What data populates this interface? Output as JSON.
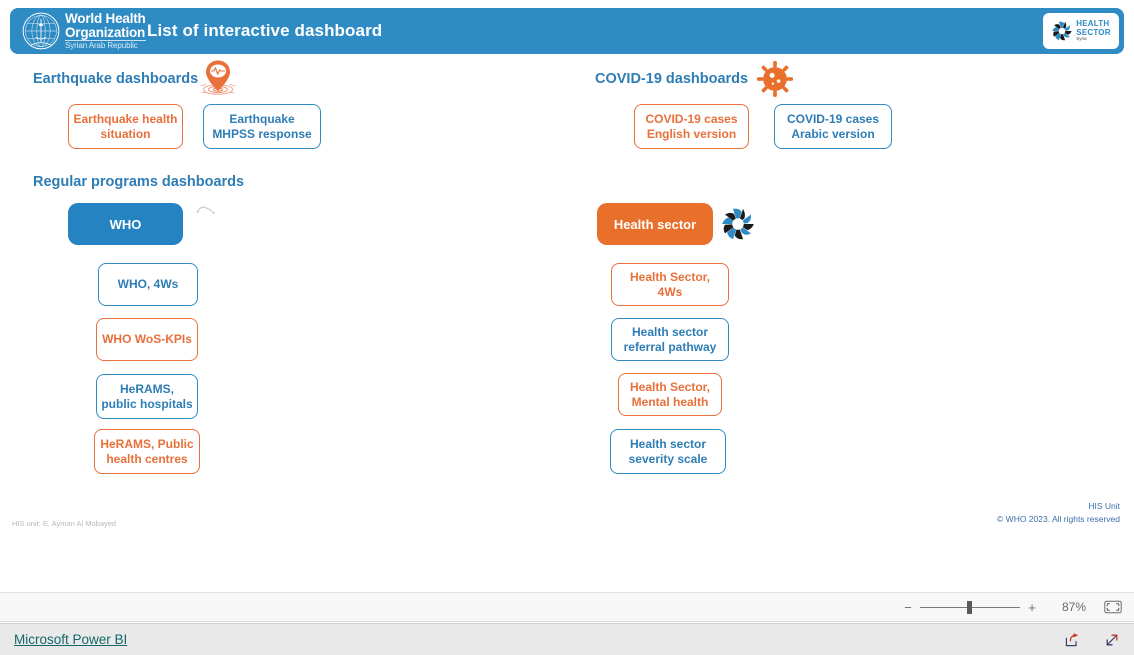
{
  "header": {
    "title": "List of interactive dashboard",
    "who_logo": {
      "line1": "World Health",
      "line2": "Organization",
      "line3": "Syrian Arab Republic",
      "icon": "who-emblem-icon"
    },
    "health_sector_logo": {
      "line1": "HEALTH",
      "line2": "SECTOR",
      "line3": "Syria",
      "icon": "health-sector-swirl-icon"
    },
    "background_color": "#2E8BC4"
  },
  "sections": {
    "earthquake": {
      "heading": "Earthquake dashboards",
      "icon": "earthquake-pin-icon",
      "buttons": [
        {
          "label": "Earthquake health situation",
          "style": "orange"
        },
        {
          "label": "Earthquake MHPSS response",
          "style": "blue"
        }
      ]
    },
    "covid": {
      "heading": "COVID-19 dashboards",
      "icon": "coronavirus-icon",
      "buttons": [
        {
          "label": "COVID-19 cases English version",
          "style": "orange"
        },
        {
          "label": "COVID-19 cases Arabic version",
          "style": "blue"
        }
      ]
    },
    "regular": {
      "heading": "Regular programs dashboards",
      "who_group": {
        "title": "WHO",
        "icon": "who-small-icon",
        "buttons": [
          {
            "label": "WHO, 4Ws",
            "style": "blue"
          },
          {
            "label": "WHO WoS-KPIs",
            "style": "orange"
          },
          {
            "label": "HeRAMS, public hospitals",
            "style": "blue"
          },
          {
            "label": "HeRAMS, Public health centres",
            "style": "orange"
          }
        ]
      },
      "health_sector_group": {
        "title": "Health sector",
        "icon": "health-sector-swirl-icon",
        "buttons": [
          {
            "label": "Health Sector, 4Ws",
            "style": "orange"
          },
          {
            "label": "Health sector referral pathway",
            "style": "blue"
          },
          {
            "label": "Health Sector, Mental health",
            "style": "orange"
          },
          {
            "label": "Health sector severity scale",
            "style": "blue"
          }
        ]
      }
    }
  },
  "credits": {
    "left": "HIS unit: E. Ayman Al Mobayed",
    "right_line1": "HIS Unit",
    "right_line2": "© WHO 2023. All rights reserved"
  },
  "zoom_bar": {
    "minus_label": "−",
    "plus_label": "+",
    "value": "87%",
    "fit_icon": "fit-to-page-icon"
  },
  "powerbi_bar": {
    "link_label": "Microsoft Power BI",
    "share_icon": "share-icon",
    "fullscreen_icon": "fullscreen-icon"
  },
  "colors": {
    "brand_blue": "#2E8BC4",
    "brand_orange": "#E8703A",
    "heading_blue": "#2E7DB5",
    "powerbi_teal": "#13676b"
  }
}
